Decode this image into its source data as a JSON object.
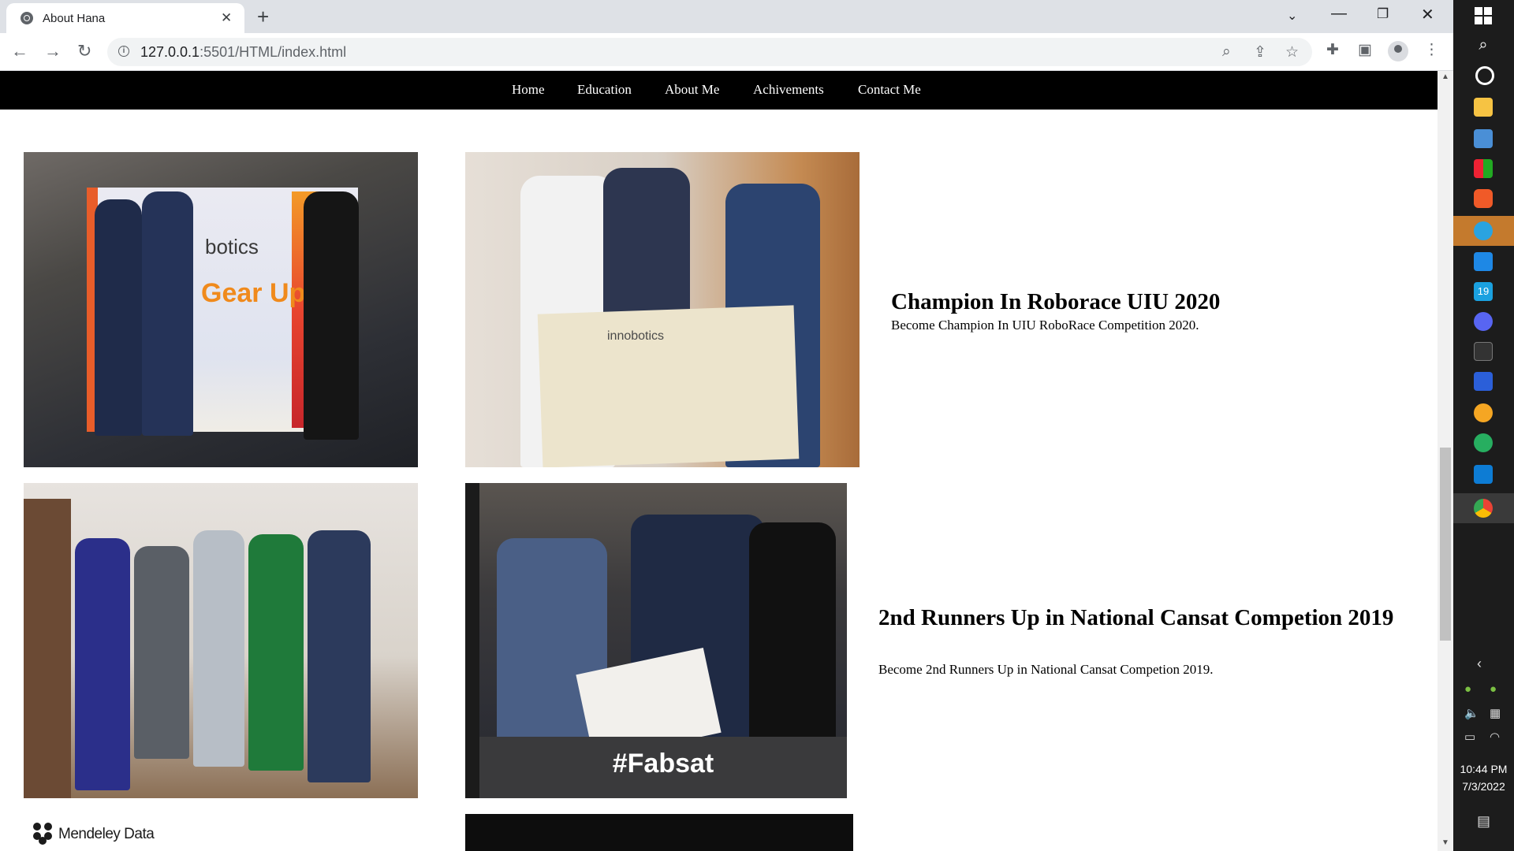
{
  "browser": {
    "tab_title": "About Hana",
    "url_host": "127.0.0.1",
    "url_rest": ":5501/HTML/index.html"
  },
  "nav": {
    "items": [
      "Home",
      "Education",
      "About Me",
      "Achivements",
      "Contact Me"
    ]
  },
  "photos": {
    "p1_banner_line1": "botics",
    "p1_banner_line2": "Gear Up",
    "p2_cheque_text": "innobotics",
    "p4_caption": "#Fabsat",
    "mendeley_text": "Mendeley Data"
  },
  "achievements": [
    {
      "title": "Champion In Roborace UIU 2020",
      "desc": "Become Champion In UIU RoboRace Competition 2020."
    },
    {
      "title": "2nd Runners Up in National Cansat Competion 2019",
      "desc": "Become 2nd Runners Up in National Cansat Competion 2019."
    }
  ],
  "taskbar": {
    "time": "10:44 PM",
    "date": "7/3/2022"
  },
  "colors": {
    "nav_bg": "#000000",
    "taskbar_bg": "#1c1c1c",
    "tabbar_bg": "#dee1e6"
  }
}
